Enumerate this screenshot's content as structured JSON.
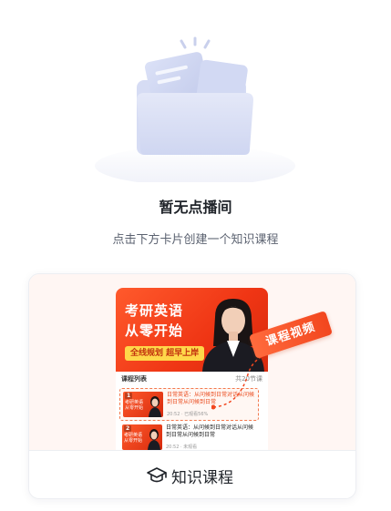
{
  "empty_state": {
    "title": "暂无点播间",
    "description": "点击下方卡片创建一个知识课程"
  },
  "card": {
    "preview": {
      "banner_line1": "考研英语",
      "banner_line2": "从零开始",
      "banner_tag": "全线规划 超早上岸",
      "ribbon_label": "课程视频",
      "list_header": "课程列表",
      "list_count": "共20节课",
      "lessons": [
        {
          "number": "1",
          "thumb_text": "考研英语 从零开始",
          "title": "日常英语：从问候到日常对话从问候到日常从问候到日常",
          "meta": "20:52 · 已观看56%",
          "highlighted": true
        },
        {
          "number": "2",
          "thumb_text": "考研英语 从零开始",
          "title": "日常英语：从问候到日常对话从问候到日常从问候到日常",
          "meta": "20:52 · 未观看",
          "highlighted": false
        }
      ]
    },
    "create_button": {
      "label": "知识课程",
      "icon": "graduation-cap-icon"
    }
  },
  "colors": {
    "accent": "#ef3514",
    "ribbon": "#f2461e",
    "tag": "#ffd74a"
  }
}
